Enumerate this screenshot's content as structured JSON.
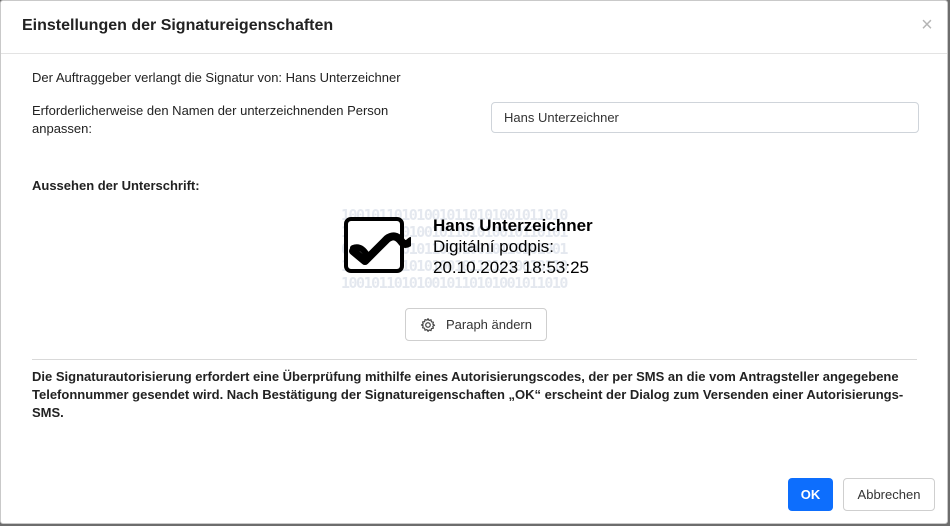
{
  "dialog": {
    "title": "Einstellungen der Signatureigenschaften",
    "close_label": "×",
    "requester_text": "Der Auftraggeber verlangt die Signatur von: Hans Unterzeichner",
    "name_label": "Erforderlicherweise den Namen der unterzeichnenden Person anpassen:",
    "name_value": "Hans Unterzeichner",
    "appearance_label": "Aussehen der Unterschrift:",
    "signature": {
      "binary_lines": [
        "100101101010010110101001011010",
        "101011010100101101010010110101",
        "010110100101101010010110101001",
        "101001011010100101101010010110",
        "100101101010010110101001011010"
      ],
      "name": "Hans Unterzeichner",
      "line2": "Digitální podpis:",
      "timestamp": "20.10.2023 18:53:25"
    },
    "paraph_button": "Paraph ändern",
    "info_text": "Die Signaturautorisierung erfordert eine Überprüfung mithilfe eines Autorisierungscodes, der per SMS an die vom Antragsteller angegebene Telefonnummer gesendet wird. Nach Bestätigung der Signatureigenschaften „OK“ erscheint der Dialog zum Versenden einer Autorisierungs-SMS.",
    "ok_button": "OK",
    "cancel_button": "Abbrechen"
  },
  "colors": {
    "primary": "#0d6efd",
    "binary_watermark": "#e4e8ef"
  }
}
